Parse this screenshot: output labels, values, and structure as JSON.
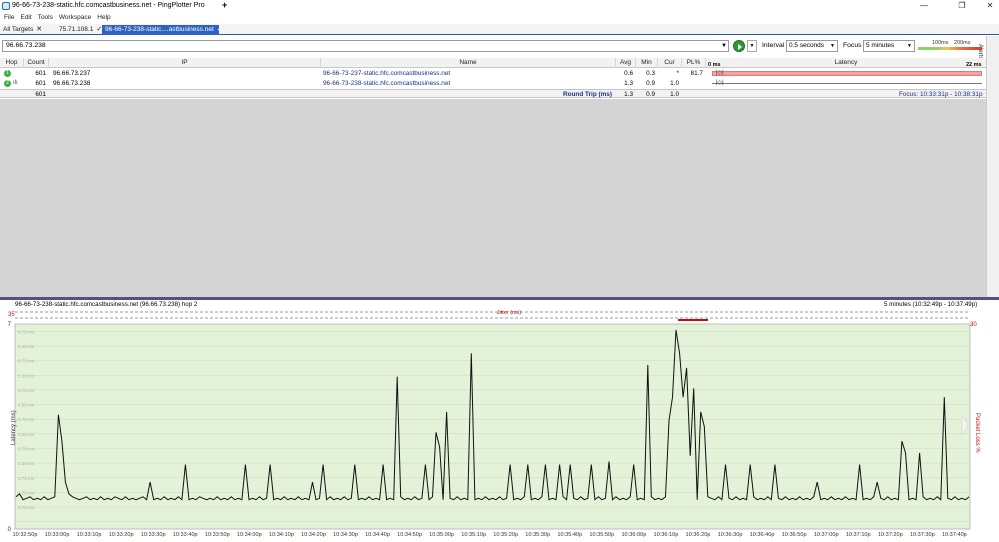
{
  "window": {
    "title": "96-66-73-238-static.hfc.comcastbusiness.net - PingPlotter Pro",
    "buttons": {
      "minimize": "—",
      "maximize": "❐",
      "close": "✕"
    }
  },
  "menu": [
    "File",
    "Edit",
    "Tools",
    "Workspace",
    "Help"
  ],
  "tabs": [
    {
      "label": "All Targets",
      "icon": "✕"
    },
    {
      "label": "75.71.108.1",
      "icon": "✓"
    },
    {
      "label": "96-66-73-238-static....astbusiness.net",
      "icon": "✓"
    }
  ],
  "tab_add_label": "+",
  "alerts_label": "Alerts",
  "target": {
    "value": "96.66.73.238",
    "interval_label": "Interval",
    "interval_value": "0.5 seconds",
    "focus_label": "Focus",
    "focus_value": "5 minutes",
    "scale_100": "100ms",
    "scale_200": "200ms"
  },
  "grid": {
    "headers": {
      "hop": "Hop",
      "count": "Count",
      "ip": "IP",
      "name": "Name",
      "avg": "Avg",
      "min": "Min",
      "cur": "Cur",
      "pl": "PL%",
      "latency": "Latency",
      "lat_min": "0 ms",
      "lat_max": "22 ms"
    },
    "rows": [
      {
        "hop": "1",
        "count": "601",
        "ip": "96.66.73.237",
        "name": "96-66-73-237-static.hfc.comcastbusiness.net",
        "avg": "0.6",
        "min": "0.3",
        "cur": "*",
        "pl": "81.7"
      },
      {
        "hop": "2",
        "count": "601",
        "ip": "96.66.73.238",
        "name": "96-66-73-238-static.hfc.comcastbusiness.net",
        "avg": "1.3",
        "min": "0.9",
        "cur": "1.0",
        "pl": ""
      }
    ],
    "roundtrip": {
      "count": "601",
      "label": "Round Trip (ms)",
      "avg": "1.3",
      "min": "0.9",
      "cur": "1.0",
      "focus": "Focus: 10:33:31p - 10:38:31p"
    }
  },
  "graph": {
    "title": "96-66-73-238-static.hfc.comcastbusiness.net (96.66.73.238) hop 2",
    "range": "5 minutes (10:32:49p - 10:37:49p)",
    "jitter_label": "Jitter (ms)",
    "jitter_max": "35",
    "pl_max": "30",
    "ylabel": "Latency (ms)",
    "pl_axis_label": "Packet Loss %",
    "colors": {
      "background": "#e3f2d9",
      "line": "#111111",
      "loss": "#b11111"
    }
  },
  "chart_data": {
    "type": "line",
    "title": "96-66-73-238-static.hfc.comcastbusiness.net (96.66.73.238) hop 2",
    "xlabel": "",
    "ylabel": "Latency (ms)",
    "ylim": [
      0,
      7
    ],
    "y_ticks": [
      "0",
      "",
      "",
      "",
      "",
      "",
      "",
      "7"
    ],
    "y_grid_labels": [
      "",
      "0.75 ms",
      "1.25 ms",
      "1.75 ms",
      "2.25 ms",
      "2.75 ms",
      "3.25 ms",
      "3.75 ms",
      "4.25 ms",
      "4.75 ms",
      "5.25 ms",
      "5.75 ms",
      "6.25 ms",
      "6.75 ms"
    ],
    "x_ticks": [
      "10:32:50p",
      "10:33:00p",
      "10:33:10p",
      "10:33:20p",
      "10:33:30p",
      "10:33:40p",
      "10:33:50p",
      "10:34:00p",
      "10:34:10p",
      "10:34:20p",
      "10:34:30p",
      "10:34:40p",
      "10:34:50p",
      "10:35:00p",
      "10:35:10p",
      "10:35:20p",
      "10:35:30p",
      "10:35:40p",
      "10:35:50p",
      "10:36:00p",
      "10:36:10p",
      "10:36:20p",
      "10:36:30p",
      "10:36:40p",
      "10:36:50p",
      "10:37:00p",
      "10:37:10p",
      "10:37:20p",
      "10:37:30p",
      "10:37:40p"
    ],
    "series": [
      {
        "values": [
          1.1,
          1.2,
          1.0,
          1.05,
          1.1,
          1.0,
          1.05,
          1.0,
          1.1,
          1.0,
          1.05,
          1.1,
          3.9,
          3.0,
          1.6,
          1.2,
          1.1,
          1.05,
          1.0,
          1.05,
          1.1,
          1.0,
          1.05,
          1.0,
          1.1,
          1.0,
          1.05,
          1.0,
          1.1,
          1.05,
          1.0,
          1.1,
          1.0,
          1.05,
          1.0,
          1.05,
          1.1,
          1.0,
          1.6,
          1.0,
          1.05,
          1.0,
          1.1,
          1.0,
          1.05,
          1.0,
          1.1,
          1.0,
          2.2,
          1.0,
          1.05,
          1.0,
          1.1,
          1.05,
          1.0,
          1.05,
          1.0,
          1.1,
          1.0,
          1.05,
          1.0,
          1.1,
          1.0,
          1.05,
          1.0,
          2.2,
          1.0,
          1.05,
          1.0,
          1.1,
          1.0,
          1.05,
          2.2,
          1.0,
          1.05,
          1.0,
          1.1,
          1.0,
          1.05,
          1.0,
          1.1,
          1.0,
          1.05,
          1.0,
          1.6,
          1.0,
          1.05,
          2.2,
          1.0,
          1.1,
          1.0,
          1.05,
          1.0,
          1.1,
          1.0,
          1.05,
          2.2,
          1.0,
          1.05,
          1.0,
          1.1,
          1.0,
          1.05,
          1.0,
          2.2,
          1.0,
          1.05,
          1.0,
          5.2,
          1.1,
          1.0,
          1.05,
          1.0,
          1.1,
          1.0,
          1.05,
          2.2,
          1.0,
          1.1,
          3.3,
          2.8,
          1.0,
          4.0,
          1.05,
          1.0,
          1.1,
          1.0,
          1.05,
          1.0,
          6.0,
          1.0,
          1.05,
          1.0,
          1.1,
          1.0,
          1.05,
          1.0,
          1.1,
          1.0,
          1.05,
          2.2,
          1.0,
          1.05,
          1.0,
          1.1,
          2.2,
          1.0,
          1.05,
          1.0,
          1.1,
          2.2,
          1.0,
          1.05,
          1.0,
          2.2,
          1.1,
          1.0,
          2.2,
          1.05,
          1.0,
          1.1,
          1.0,
          1.05,
          2.2,
          1.0,
          1.1,
          1.0,
          1.05,
          2.3,
          1.0,
          1.1,
          1.0,
          1.05,
          1.0,
          1.1,
          2.2,
          1.0,
          1.05,
          1.0,
          5.6,
          1.1,
          1.0,
          1.05,
          1.0,
          1.1,
          3.7,
          4.5,
          6.8,
          6.0,
          4.5,
          5.5,
          2.5,
          4.8,
          1.0,
          4.0,
          3.5,
          1.1,
          1.05,
          1.0,
          1.1,
          1.0,
          2.2,
          1.05,
          1.0,
          1.1,
          1.0,
          1.05,
          1.0,
          2.2,
          1.1,
          1.0,
          1.05,
          1.0,
          1.1,
          1.0,
          2.2,
          1.05,
          1.0,
          1.1,
          1.0,
          1.05,
          1.0,
          1.1,
          1.0,
          1.05,
          1.0,
          1.1,
          1.6,
          1.0,
          1.05,
          1.0,
          1.1,
          1.0,
          1.05,
          1.0,
          1.1,
          1.0,
          1.05,
          1.0,
          2.2,
          1.0,
          1.05,
          1.0,
          1.1,
          1.6,
          1.05,
          1.0,
          1.1,
          1.0,
          1.05,
          1.0,
          3.0,
          2.6,
          1.0,
          1.05,
          1.0,
          2.6,
          1.1,
          1.0,
          1.05,
          1.0,
          1.1,
          1.0,
          4.5,
          1.05,
          1.0,
          1.1,
          1.0,
          1.05,
          1.0,
          1.1
        ]
      }
    ],
    "grid": true,
    "legend": "none"
  }
}
